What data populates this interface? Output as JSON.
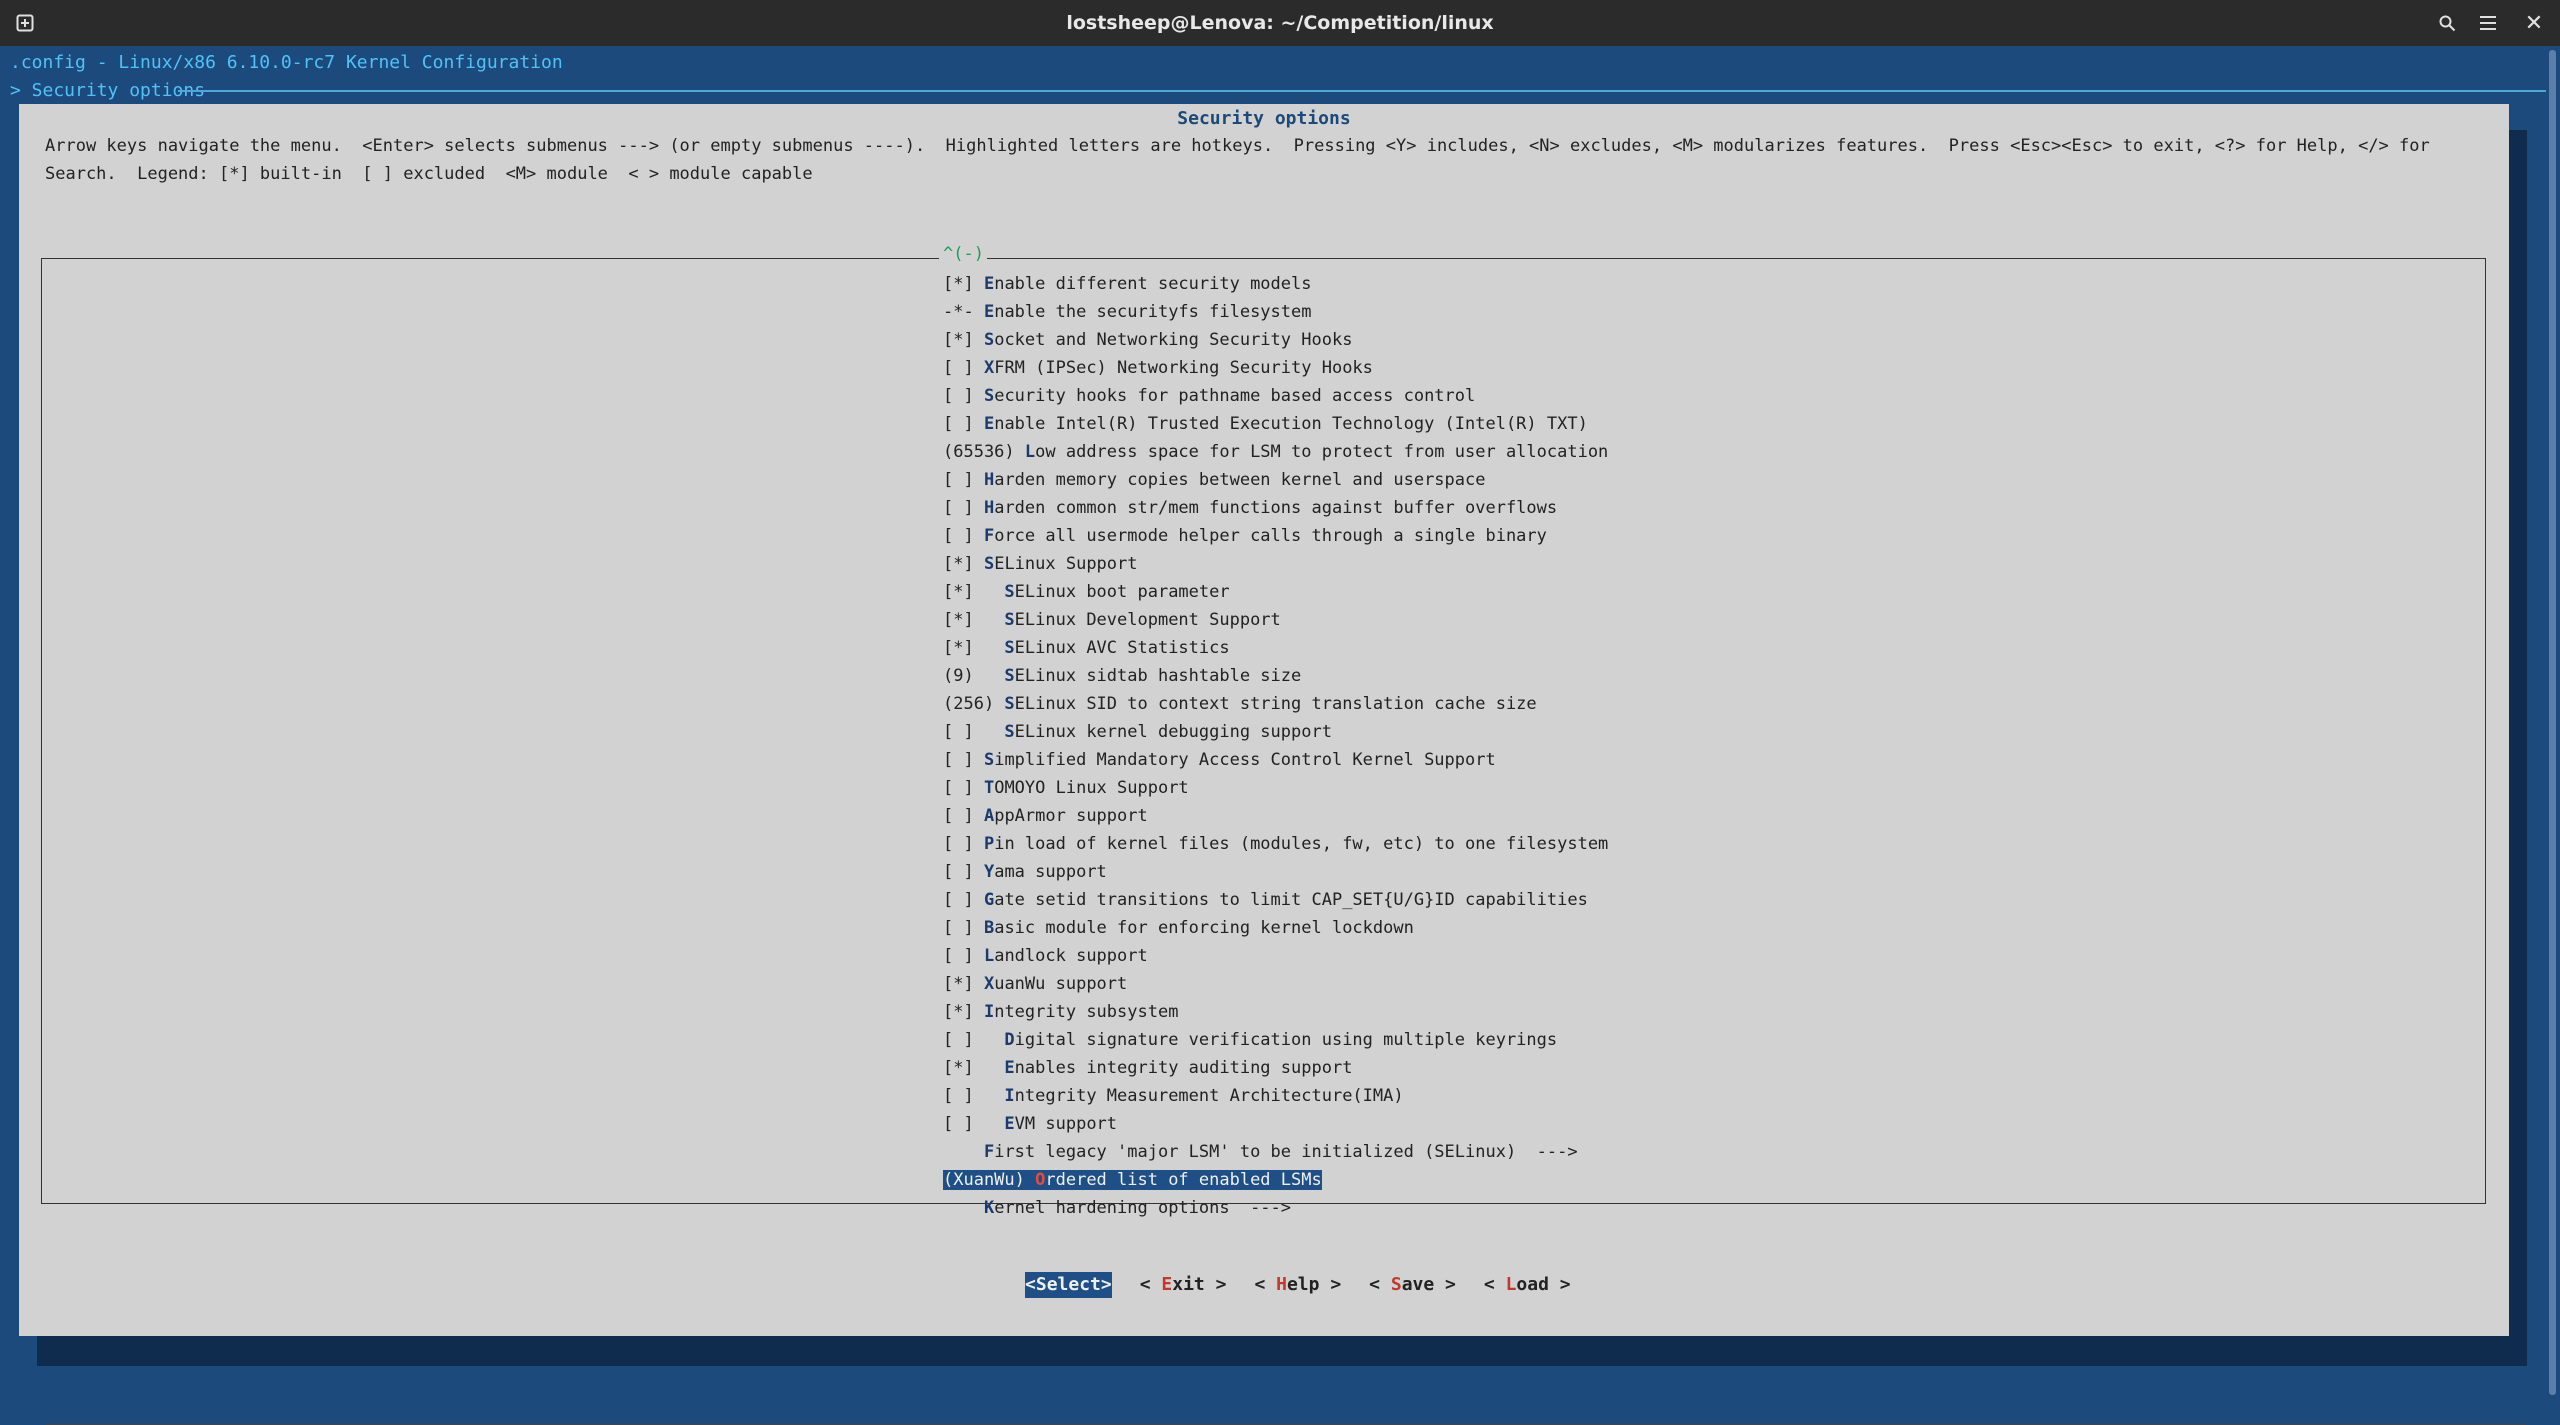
{
  "window": {
    "title": "lostsheep@Lenova: ~/Competition/linux",
    "new_tab_icon": "new-tab-icon",
    "search_icon": "search-icon",
    "menu_icon": "hamburger-menu-icon",
    "close_icon": "close-icon"
  },
  "terminal": {
    "header_line1": ".config - Linux/x86 6.10.0-rc7 Kernel Configuration",
    "header_line2": "> Security options"
  },
  "dialog": {
    "title": "Security options",
    "help_text": "Arrow keys navigate the menu.  <Enter> selects submenus ---> (or empty submenus ----).  Highlighted letters are hotkeys.  Pressing <Y> includes, <N> excludes, <M> modularizes features.  Press <Esc><Esc> to exit, <?> for Help, </> for Search.  Legend: [*] built-in  [ ] excluded  <M> module  < > module capable",
    "scroll_indicator": "^(-)",
    "items": [
      {
        "prefix": "[*] ",
        "hotkey": "E",
        "rest": "nable different security models"
      },
      {
        "prefix": "-*- ",
        "hotkey": "E",
        "rest": "nable the securityfs filesystem"
      },
      {
        "prefix": "[*] ",
        "hotkey": "S",
        "rest": "ocket and Networking Security Hooks"
      },
      {
        "prefix": "[ ] ",
        "hotkey": "X",
        "rest": "FRM (IPSec) Networking Security Hooks"
      },
      {
        "prefix": "[ ] ",
        "hotkey": "S",
        "rest": "ecurity hooks for pathname based access control"
      },
      {
        "prefix": "[ ] ",
        "hotkey": "E",
        "rest": "nable Intel(R) Trusted Execution Technology (Intel(R) TXT)"
      },
      {
        "prefix": "(65536) ",
        "hotkey": "L",
        "rest": "ow address space for LSM to protect from user allocation"
      },
      {
        "prefix": "[ ] ",
        "hotkey": "H",
        "rest": "arden memory copies between kernel and userspace"
      },
      {
        "prefix": "[ ] ",
        "hotkey": "H",
        "rest": "arden common str/mem functions against buffer overflows"
      },
      {
        "prefix": "[ ] ",
        "hotkey": "F",
        "rest": "orce all usermode helper calls through a single binary"
      },
      {
        "prefix": "[*] ",
        "hotkey": "S",
        "rest": "ELinux Support"
      },
      {
        "prefix": "[*]   ",
        "hotkey": "S",
        "rest": "ELinux boot parameter"
      },
      {
        "prefix": "[*]   ",
        "hotkey": "S",
        "rest": "ELinux Development Support"
      },
      {
        "prefix": "[*]   ",
        "hotkey": "S",
        "rest": "ELinux AVC Statistics"
      },
      {
        "prefix": "(9)   ",
        "hotkey": "S",
        "rest": "ELinux sidtab hashtable size"
      },
      {
        "prefix": "(256) ",
        "hotkey": "S",
        "rest": "ELinux SID to context string translation cache size"
      },
      {
        "prefix": "[ ]   ",
        "hotkey": "S",
        "rest": "ELinux kernel debugging support"
      },
      {
        "prefix": "[ ] ",
        "hotkey": "S",
        "rest": "implified Mandatory Access Control Kernel Support"
      },
      {
        "prefix": "[ ] ",
        "hotkey": "T",
        "rest": "OMOYO Linux Support"
      },
      {
        "prefix": "[ ] ",
        "hotkey": "A",
        "rest": "ppArmor support"
      },
      {
        "prefix": "[ ] ",
        "hotkey": "P",
        "rest": "in load of kernel files (modules, fw, etc) to one filesystem"
      },
      {
        "prefix": "[ ] ",
        "hotkey": "Y",
        "rest": "ama support"
      },
      {
        "prefix": "[ ] ",
        "hotkey": "G",
        "rest": "ate setid transitions to limit CAP_SET{U/G}ID capabilities"
      },
      {
        "prefix": "[ ] ",
        "hotkey": "B",
        "rest": "asic module for enforcing kernel lockdown"
      },
      {
        "prefix": "[ ] ",
        "hotkey": "L",
        "rest": "andlock support"
      },
      {
        "prefix": "[*] ",
        "hotkey": "X",
        "rest": "uanWu support"
      },
      {
        "prefix": "[*] ",
        "hotkey": "I",
        "rest": "ntegrity subsystem"
      },
      {
        "prefix": "[ ]   ",
        "hotkey": "D",
        "rest": "igital signature verification using multiple keyrings"
      },
      {
        "prefix": "[*]   ",
        "hotkey": "E",
        "rest": "nables integrity auditing support"
      },
      {
        "prefix": "[ ]   ",
        "hotkey": "I",
        "rest": "ntegrity Measurement Architecture(IMA)"
      },
      {
        "prefix": "[ ]   ",
        "hotkey": "E",
        "rest": "VM support"
      },
      {
        "prefix": "    ",
        "hotkey": "F",
        "rest": "irst legacy 'major LSM' to be initialized (SELinux)  --->"
      },
      {
        "prefix": "(XuanWu) ",
        "hotkey": "O",
        "rest": "rdered list of enabled LSMs",
        "selected": true
      },
      {
        "prefix": "    ",
        "hotkey": "K",
        "rest": "ernel hardening options  --->"
      }
    ],
    "buttons": [
      {
        "pre": "<",
        "hotkey": "S",
        "rest": "elect>",
        "selected": true
      },
      {
        "pre": "< ",
        "hotkey": "E",
        "rest": "xit >"
      },
      {
        "pre": "< ",
        "hotkey": "H",
        "rest": "elp >"
      },
      {
        "pre": "< ",
        "hotkey": "S",
        "rest": "ave >"
      },
      {
        "pre": "< ",
        "hotkey": "L",
        "rest": "oad >"
      }
    ]
  }
}
